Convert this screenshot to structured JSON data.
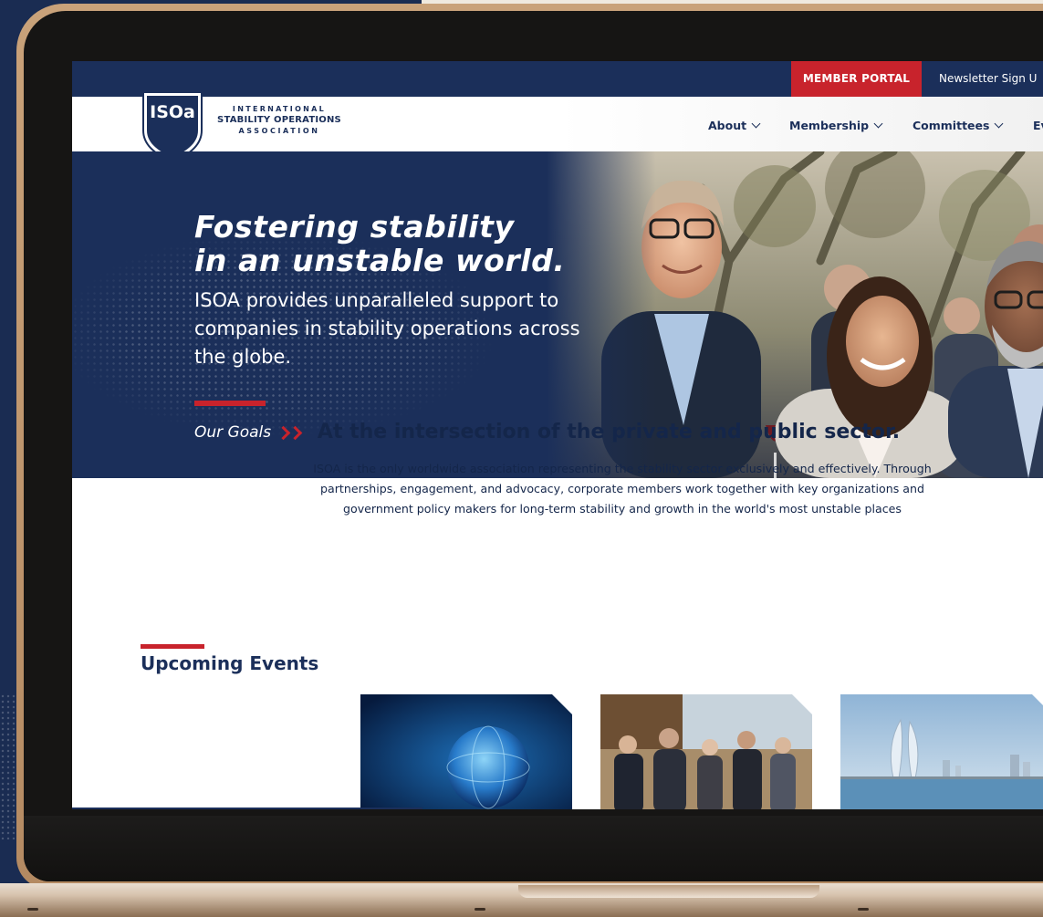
{
  "topbar": {
    "member_portal_label": "MEMBER PORTAL",
    "newsletter_label": "Newsletter Sign U"
  },
  "logo": {
    "mark": "ISOa",
    "line1": "INTERNATIONAL",
    "line2": "STABILITY OPERATIONS",
    "line3": "ASSOCIATION"
  },
  "nav": {
    "items": [
      {
        "label": "About"
      },
      {
        "label": "Membership"
      },
      {
        "label": "Committees"
      },
      {
        "label": "Ev"
      }
    ]
  },
  "hero": {
    "title_line1": "Fostering stability",
    "title_line2": "in an unstable world.",
    "subtitle": "ISOA provides unparalleled support to companies in stability operations across the globe.",
    "link_label": "Our Goals"
  },
  "intro": {
    "title": "At the intersection of the private and public sector.",
    "body_line1": "ISOA is the only worldwide association representing the stability sector exclusively and effectively. Through",
    "body_line2": "partnerships, engagement, and advocacy, corporate members work together with key organizations and",
    "body_line3": "government policy makers for long-term stability and growth in the world's most unstable places"
  },
  "events": {
    "heading": "Upcoming Events"
  },
  "colors": {
    "navy": "#1b2f5a",
    "red": "#c8232c",
    "white": "#ffffff"
  },
  "icons": {
    "nav_dropdown": "chevron-down-icon",
    "link_arrow": "double-chevron-right-icon"
  }
}
